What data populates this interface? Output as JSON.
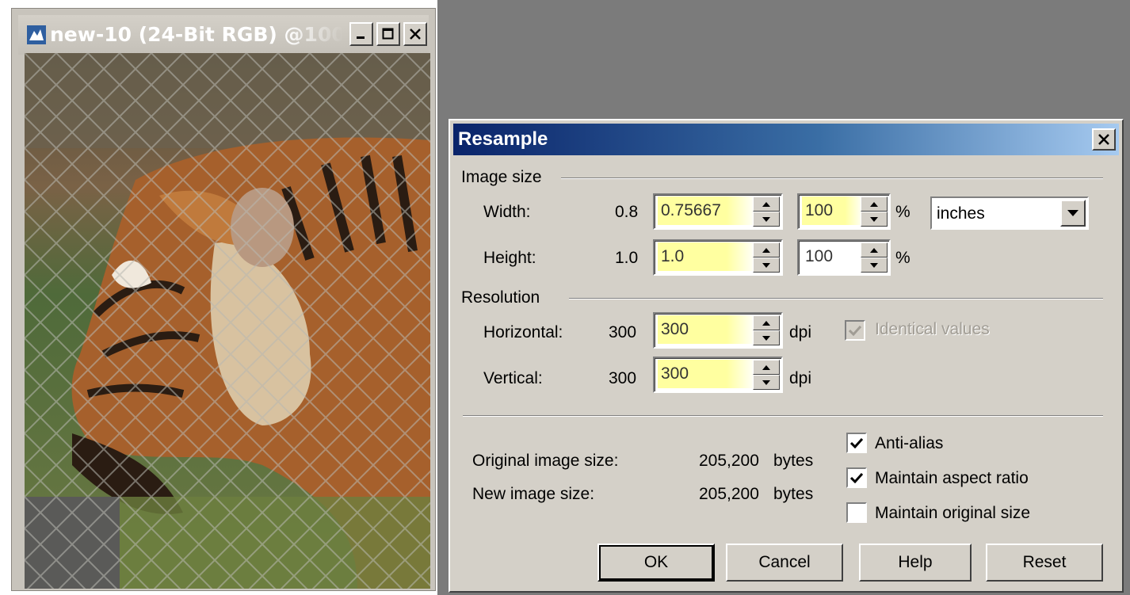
{
  "image_window": {
    "title": "new-10 (24-Bit RGB) @100...",
    "controls": [
      "minimize",
      "maximize",
      "close"
    ]
  },
  "dialog": {
    "title": "Resample",
    "image_size": {
      "group_label": "Image size",
      "width": {
        "label": "Width:",
        "original": "0.8",
        "value": "0.75667",
        "percent": "100",
        "percent_symbol": "%"
      },
      "height": {
        "label": "Height:",
        "original": "1.0",
        "value": "1.0",
        "percent": "100",
        "percent_symbol": "%"
      },
      "units": "inches"
    },
    "resolution": {
      "group_label": "Resolution",
      "horizontal": {
        "label": "Horizontal:",
        "original": "300",
        "value": "300",
        "unit": "dpi"
      },
      "vertical": {
        "label": "Vertical:",
        "original": "300",
        "value": "300",
        "unit": "dpi"
      },
      "identical_values": {
        "label": "Identical values",
        "checked": true,
        "enabled": false
      }
    },
    "sizes": {
      "original_label": "Original image size:",
      "original_value": "205,200",
      "new_label": "New image size:",
      "new_value": "205,200",
      "unit": "bytes"
    },
    "options": {
      "anti_alias": {
        "label": "Anti-alias",
        "checked": true
      },
      "maintain_aspect": {
        "label": "Maintain aspect ratio",
        "checked": true
      },
      "maintain_original": {
        "label": "Maintain original size",
        "checked": false
      }
    },
    "buttons": {
      "ok": "OK",
      "cancel": "Cancel",
      "help": "Help",
      "reset": "Reset"
    }
  }
}
